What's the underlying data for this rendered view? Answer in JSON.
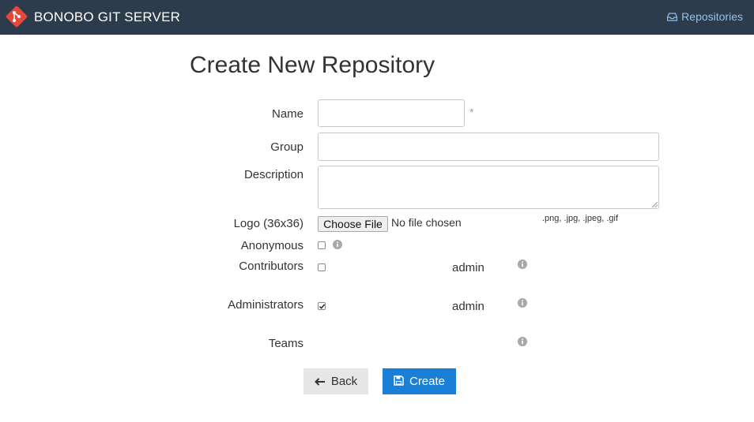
{
  "app": {
    "brand_title": "BONOBO GIT SERVER",
    "brand_color": "#e8483b",
    "nav_link": "Repositories",
    "nav_icon": "inbox-icon"
  },
  "page": {
    "title": "Create New Repository"
  },
  "form": {
    "name": {
      "label": "Name",
      "value": "",
      "required_marker": "*"
    },
    "group": {
      "label": "Group",
      "value": ""
    },
    "description": {
      "label": "Description",
      "value": ""
    },
    "logo": {
      "label": "Logo (36x36)",
      "button_label": "Choose File",
      "status": "No file chosen",
      "hint": ".png, .jpg, .jpeg, .gif"
    },
    "anonymous": {
      "label": "Anonymous",
      "checked": false
    },
    "contributors": {
      "label": "Contributors",
      "user": "admin",
      "checked": false
    },
    "administrators": {
      "label": "Administrators",
      "user": "admin",
      "checked": true
    },
    "teams": {
      "label": "Teams"
    }
  },
  "actions": {
    "back_label": "Back",
    "create_label": "Create"
  },
  "colors": {
    "topbar": "#2d3c4c",
    "link": "#8fc3ea",
    "primary": "#1a7fd6",
    "secondary": "#e6e6e6"
  }
}
